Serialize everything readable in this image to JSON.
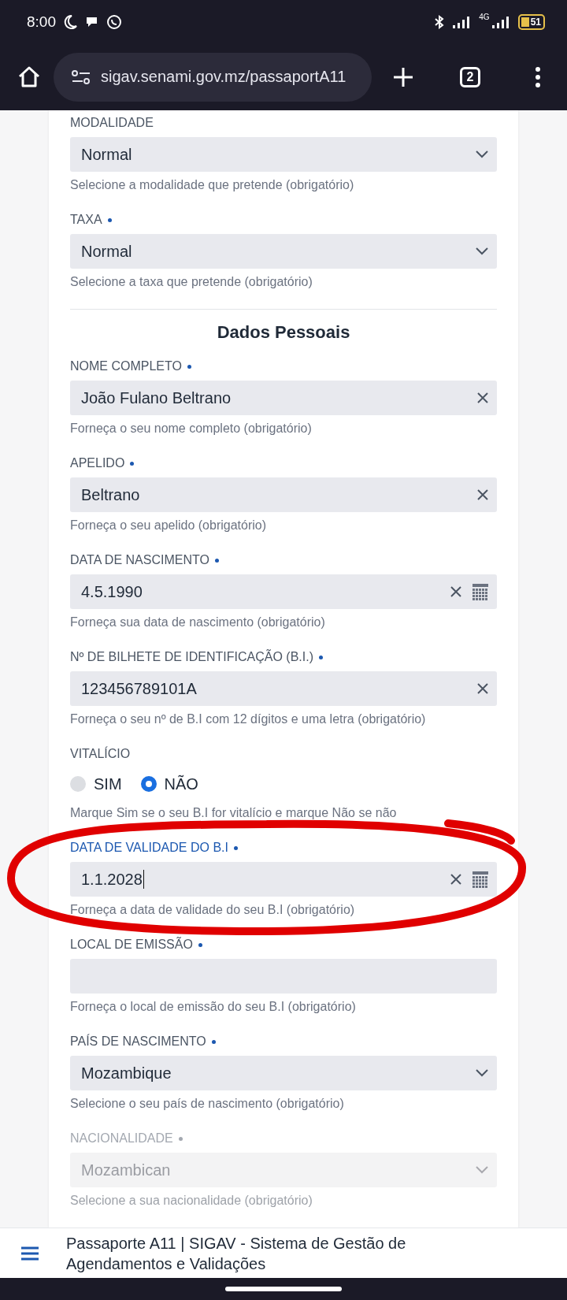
{
  "status_bar": {
    "time": "8:00",
    "network": "4G",
    "battery": "51"
  },
  "browser": {
    "url": "sigav.senami.gov.mz/passaportA11",
    "tab_count": "2"
  },
  "form_items": [
    {
      "kind": "select",
      "label": "MODALIDADE",
      "required": false,
      "disabled": false,
      "focused": false,
      "circled": false,
      "value": "Normal",
      "hint": "Selecione a modalidade que pretende (obrigatório)"
    },
    {
      "kind": "select",
      "label": "TAXA",
      "required": true,
      "disabled": false,
      "focused": false,
      "circled": false,
      "value": "Normal",
      "hint": "Selecione a taxa que pretende (obrigatório)"
    },
    {
      "kind": "heading",
      "label": "Dados Pessoais"
    },
    {
      "kind": "text",
      "label": "NOME COMPLETO",
      "required": true,
      "disabled": false,
      "focused": false,
      "circled": false,
      "value": "João Fulano Beltrano",
      "hint": "Forneça o seu nome completo (obrigatório)"
    },
    {
      "kind": "text",
      "label": "APELIDO",
      "required": true,
      "disabled": false,
      "focused": false,
      "circled": false,
      "value": "Beltrano",
      "hint": "Forneça o seu apelido (obrigatório)"
    },
    {
      "kind": "date",
      "label": "DATA DE NASCIMENTO",
      "required": true,
      "disabled": false,
      "focused": false,
      "circled": false,
      "value": "4.5.1990",
      "hint": "Forneça sua data de nascimento (obrigatório)"
    },
    {
      "kind": "text",
      "label": "Nº DE BILHETE DE IDENTIFICAÇÃO (B.I.)",
      "required": true,
      "disabled": false,
      "focused": false,
      "circled": false,
      "value": "123456789101A",
      "hint": "Forneça o seu nº de B.I com 12 dígitos e uma letra (obrigatório)"
    },
    {
      "kind": "radio",
      "label": "VITALÍCIO",
      "required": false,
      "disabled": false,
      "focused": false,
      "circled": false,
      "options": [
        {
          "label": "SIM",
          "selected": false
        },
        {
          "label": "NÃO",
          "selected": true
        }
      ],
      "hint": "Marque Sim se o seu B.I for vitalício e marque Não se não"
    },
    {
      "kind": "date",
      "label": "DATA DE VALIDADE DO B.I",
      "required": true,
      "disabled": false,
      "focused": true,
      "circled": true,
      "value": "1.1.2028",
      "hint": "Forneça a data de validade do seu B.I (obrigatório)"
    },
    {
      "kind": "text",
      "label": "LOCAL DE EMISSÃO",
      "required": true,
      "disabled": false,
      "focused": false,
      "circled": false,
      "hint": "Forneça o local de emissão do seu B.I (obrigatório)"
    },
    {
      "kind": "select",
      "label": "PAÍS DE NASCIMENTO",
      "required": true,
      "disabled": false,
      "focused": false,
      "circled": false,
      "value": "Mozambique",
      "hint": "Selecione o seu país de nascimento (obrigatório)"
    },
    {
      "kind": "select",
      "label": "NACIONALIDADE",
      "required": true,
      "disabled": true,
      "focused": false,
      "circled": false,
      "value": "Mozambican",
      "hint": "Selecione a sua nacionalidade (obrigatório)"
    }
  ],
  "bottom_bar": {
    "title": "Passaporte A11 | SIGAV - Sistema de Gestão de Agendamentos e Validações"
  }
}
